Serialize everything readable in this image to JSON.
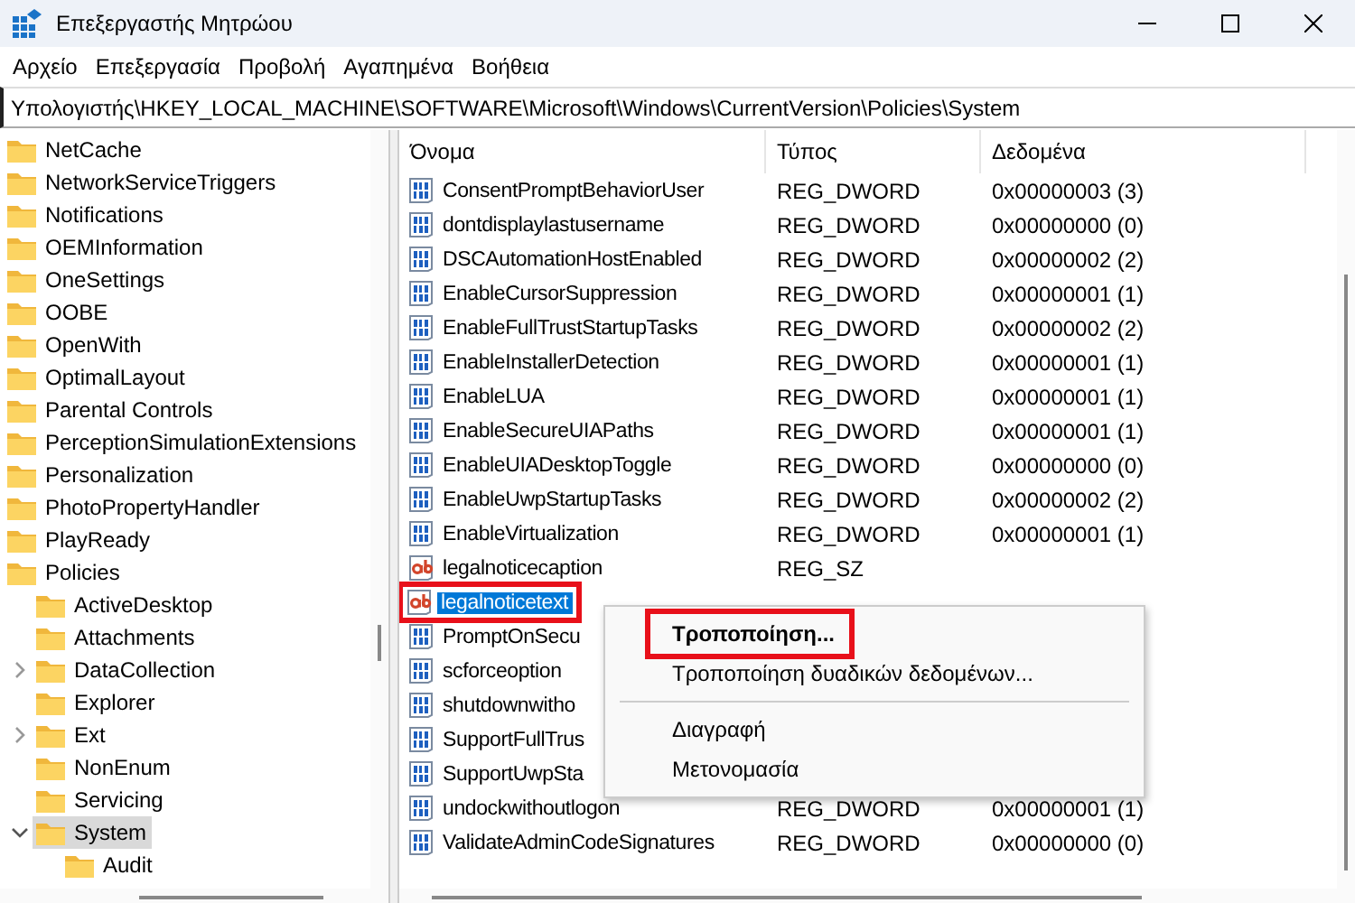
{
  "window": {
    "title": "Επεξεργαστής Μητρώου"
  },
  "menu_bar": [
    "Αρχείο",
    "Επεξεργασία",
    "Προβολή",
    "Αγαπημένα",
    "Βοήθεια"
  ],
  "address_bar": {
    "value": "Υπολογιστής\\HKEY_LOCAL_MACHINE\\SOFTWARE\\Microsoft\\Windows\\CurrentVersion\\Policies\\System"
  },
  "tree": [
    {
      "label": "NetCache",
      "selected": false
    },
    {
      "label": "NetworkServiceTriggers",
      "selected": false
    },
    {
      "label": "Notifications",
      "selected": false
    },
    {
      "label": "OEMInformation",
      "selected": false
    },
    {
      "label": "OneSettings",
      "selected": false
    },
    {
      "label": "OOBE",
      "selected": false
    },
    {
      "label": "OpenWith",
      "selected": false
    },
    {
      "label": "OptimalLayout",
      "selected": false
    },
    {
      "label": "Parental Controls",
      "selected": false
    },
    {
      "label": "PerceptionSimulationExtensions",
      "selected": false
    },
    {
      "label": "Personalization",
      "selected": false
    },
    {
      "label": "PhotoPropertyHandler",
      "selected": false
    },
    {
      "label": "PlayReady",
      "selected": false
    },
    {
      "label": "Policies",
      "selected": false,
      "children": [
        {
          "label": "ActiveDesktop",
          "selected": false
        },
        {
          "label": "Attachments",
          "selected": false
        },
        {
          "label": "DataCollection",
          "expanded": false,
          "selected": false
        },
        {
          "label": "Explorer",
          "selected": false
        },
        {
          "label": "Ext",
          "expanded": false,
          "selected": false
        },
        {
          "label": "NonEnum",
          "selected": false
        },
        {
          "label": "Servicing",
          "selected": false
        },
        {
          "label": "System",
          "expanded": true,
          "selected": true,
          "children": [
            {
              "label": "Audit",
              "selected": false
            }
          ]
        }
      ]
    }
  ],
  "table": {
    "columns": [
      "Όνομα",
      "Τύπος",
      "Δεδομένα"
    ],
    "rows": [
      {
        "kind": "dword",
        "name": "ConsentPromptBehaviorUser",
        "type": "REG_DWORD",
        "data": "0x00000003 (3)",
        "selected": false
      },
      {
        "kind": "dword",
        "name": "dontdisplaylastusername",
        "type": "REG_DWORD",
        "data": "0x00000000 (0)",
        "selected": false
      },
      {
        "kind": "dword",
        "name": "DSCAutomationHostEnabled",
        "type": "REG_DWORD",
        "data": "0x00000002 (2)",
        "selected": false
      },
      {
        "kind": "dword",
        "name": "EnableCursorSuppression",
        "type": "REG_DWORD",
        "data": "0x00000001 (1)",
        "selected": false
      },
      {
        "kind": "dword",
        "name": "EnableFullTrustStartupTasks",
        "type": "REG_DWORD",
        "data": "0x00000002 (2)",
        "selected": false
      },
      {
        "kind": "dword",
        "name": "EnableInstallerDetection",
        "type": "REG_DWORD",
        "data": "0x00000001 (1)",
        "selected": false
      },
      {
        "kind": "dword",
        "name": "EnableLUA",
        "type": "REG_DWORD",
        "data": "0x00000001 (1)",
        "selected": false
      },
      {
        "kind": "dword",
        "name": "EnableSecureUIAPaths",
        "type": "REG_DWORD",
        "data": "0x00000001 (1)",
        "selected": false
      },
      {
        "kind": "dword",
        "name": "EnableUIADesktopToggle",
        "type": "REG_DWORD",
        "data": "0x00000000 (0)",
        "selected": false
      },
      {
        "kind": "dword",
        "name": "EnableUwpStartupTasks",
        "type": "REG_DWORD",
        "data": "0x00000002 (2)",
        "selected": false
      },
      {
        "kind": "dword",
        "name": "EnableVirtualization",
        "type": "REG_DWORD",
        "data": "0x00000001 (1)",
        "selected": false
      },
      {
        "kind": "sz",
        "name": "legalnoticecaption",
        "type": "REG_SZ",
        "selected": false
      },
      {
        "kind": "sz",
        "name": "legalnoticetext",
        "selected": true,
        "outlined": true
      },
      {
        "kind": "dword",
        "name": "PromptOnSecu",
        "selected": false
      },
      {
        "kind": "dword",
        "name": "scforceoption",
        "selected": false
      },
      {
        "kind": "dword",
        "name": "shutdownwitho",
        "selected": false
      },
      {
        "kind": "dword",
        "name": "SupportFullTrus",
        "selected": false
      },
      {
        "kind": "dword",
        "name": "SupportUwpSta",
        "selected": false
      },
      {
        "kind": "dword",
        "name": "undockwithoutlogon",
        "type": "REG_DWORD",
        "data": "0x00000001 (1)",
        "selected": false
      },
      {
        "kind": "dword",
        "name": "ValidateAdminCodeSignatures",
        "type": "REG_DWORD",
        "data": "0x00000000 (0)",
        "selected": false
      }
    ]
  },
  "context_menu": [
    {
      "label": "Τροποποίηση...",
      "default": true,
      "outlined": true
    },
    {
      "label": "Τροποποίηση δυαδικών δεδομένων...",
      "default": false,
      "outlined": false,
      "separator_after": true
    },
    {
      "label": "Διαγραφή",
      "default": false,
      "outlined": false
    },
    {
      "label": "Μετονομασία",
      "default": false,
      "outlined": false
    }
  ]
}
